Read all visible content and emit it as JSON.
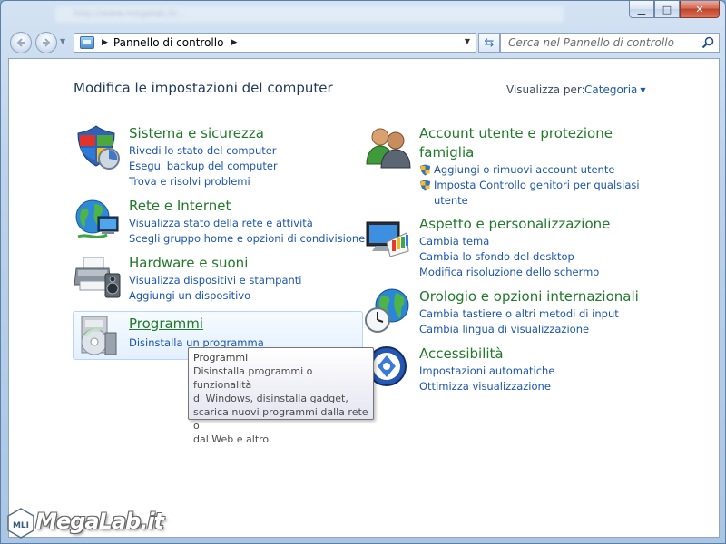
{
  "window": {
    "caption_blurred": "http://www.megalab.it/...",
    "min_glyph": "▁",
    "max_glyph": "□",
    "close_glyph": "✕"
  },
  "address_bar": {
    "breadcrumb": "Pannello di controllo",
    "separator": "▶",
    "dropdown": "▼",
    "refresh_glyph": "⇆"
  },
  "search": {
    "placeholder": "Cerca nel Pannello di controllo"
  },
  "main": {
    "title": "Modifica le impostazioni del computer",
    "view_by_label": "Visualizza per:",
    "view_by_value": "Categoria",
    "categories_left": [
      {
        "title": "Sistema e sicurezza",
        "icon": "shield-icon",
        "links": [
          "Rivedi lo stato del computer",
          "Esegui backup del computer",
          "Trova e risolvi problemi"
        ]
      },
      {
        "title": "Rete e Internet",
        "icon": "network-globe-icon",
        "links": [
          "Visualizza stato della rete e attività",
          "Scegli gruppo home e opzioni di condivisione"
        ]
      },
      {
        "title": "Hardware e suoni",
        "icon": "printer-speaker-icon",
        "links": [
          "Visualizza dispositivi e stampanti",
          "Aggiungi un dispositivo"
        ]
      },
      {
        "title": "Programmi",
        "icon": "programs-disc-icon",
        "links": [
          "Disinstalla un programma"
        ]
      }
    ],
    "categories_right": [
      {
        "title_line1": "Account utente e protezione",
        "title_line2": "famiglia",
        "icon": "users-icon",
        "links": [
          "Aggiungi o rimuovi account utente",
          "Imposta Controllo genitori per qualsiasi",
          "utente"
        ]
      },
      {
        "title": "Aspetto e personalizzazione",
        "icon": "monitor-palette-icon",
        "links": [
          "Cambia tema",
          "Cambia lo sfondo del desktop",
          "Modifica risoluzione dello schermo"
        ]
      },
      {
        "title": "Orologio e opzioni internazionali",
        "icon": "clock-globe-icon",
        "links": [
          "Cambia tastiere o altri metodi di input",
          "Cambia lingua di visualizzazione"
        ]
      },
      {
        "title": "Accessibilità",
        "icon": "accessibility-icon",
        "links": [
          "Impostazioni automatiche",
          "Ottimizza visualizzazione"
        ]
      }
    ]
  },
  "tooltip": {
    "title": "Programmi",
    "lines": [
      "Disinstalla programmi o funzionalità",
      "di Windows, disinstalla gadget,",
      "scarica nuovi programmi dalla rete o",
      "dal Web e altro."
    ]
  },
  "watermark": {
    "text": "MegaLab.it",
    "badge": "MLI"
  }
}
